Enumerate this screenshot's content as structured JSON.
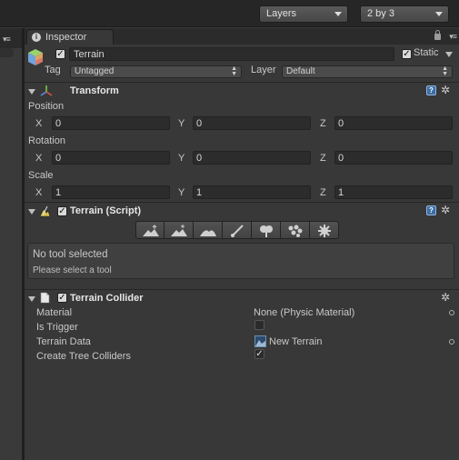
{
  "toolbar": {
    "layers_label": "Layers",
    "layout_label": "2 by 3"
  },
  "inspector": {
    "tab_label": "Inspector",
    "tab_menu_glyph": "▾≡",
    "header": {
      "active": true,
      "name": "Terrain",
      "static_label": "Static",
      "static_checked": true,
      "tag_label": "Tag",
      "tag_value": "Untagged",
      "layer_label": "Layer",
      "layer_value": "Default"
    },
    "transform": {
      "title": "Transform",
      "position_label": "Position",
      "rotation_label": "Rotation",
      "scale_label": "Scale",
      "x_label": "X",
      "y_label": "Y",
      "z_label": "Z",
      "position": {
        "x": "0",
        "y": "0",
        "z": "0"
      },
      "rotation": {
        "x": "0",
        "y": "0",
        "z": "0"
      },
      "scale": {
        "x": "1",
        "y": "1",
        "z": "1"
      }
    },
    "terrain_script": {
      "title": "Terrain (Script)",
      "enabled": true,
      "tools": [
        "raise-lower-icon",
        "paint-height-icon",
        "smooth-height-icon",
        "paint-texture-icon",
        "place-trees-icon",
        "paint-details-icon",
        "settings-icon"
      ],
      "status_title": "No tool selected",
      "status_hint": "Please select a tool"
    },
    "terrain_collider": {
      "title": "Terrain Collider",
      "enabled": true,
      "material_label": "Material",
      "material_value": "None (Physic Material)",
      "is_trigger_label": "Is Trigger",
      "is_trigger_checked": false,
      "terrain_data_label": "Terrain Data",
      "terrain_data_value": "New Terrain",
      "create_tree_colliders_label": "Create Tree Colliders",
      "create_tree_colliders_checked": true
    },
    "help_glyph": "?",
    "gear_glyph": "✲"
  },
  "colors": {
    "toolbar_bg": "#262626",
    "panel_bg": "#383838",
    "field_bg": "#2c2c2c",
    "text": "#c8c8c8",
    "help_blue": "#3c6ea5"
  }
}
